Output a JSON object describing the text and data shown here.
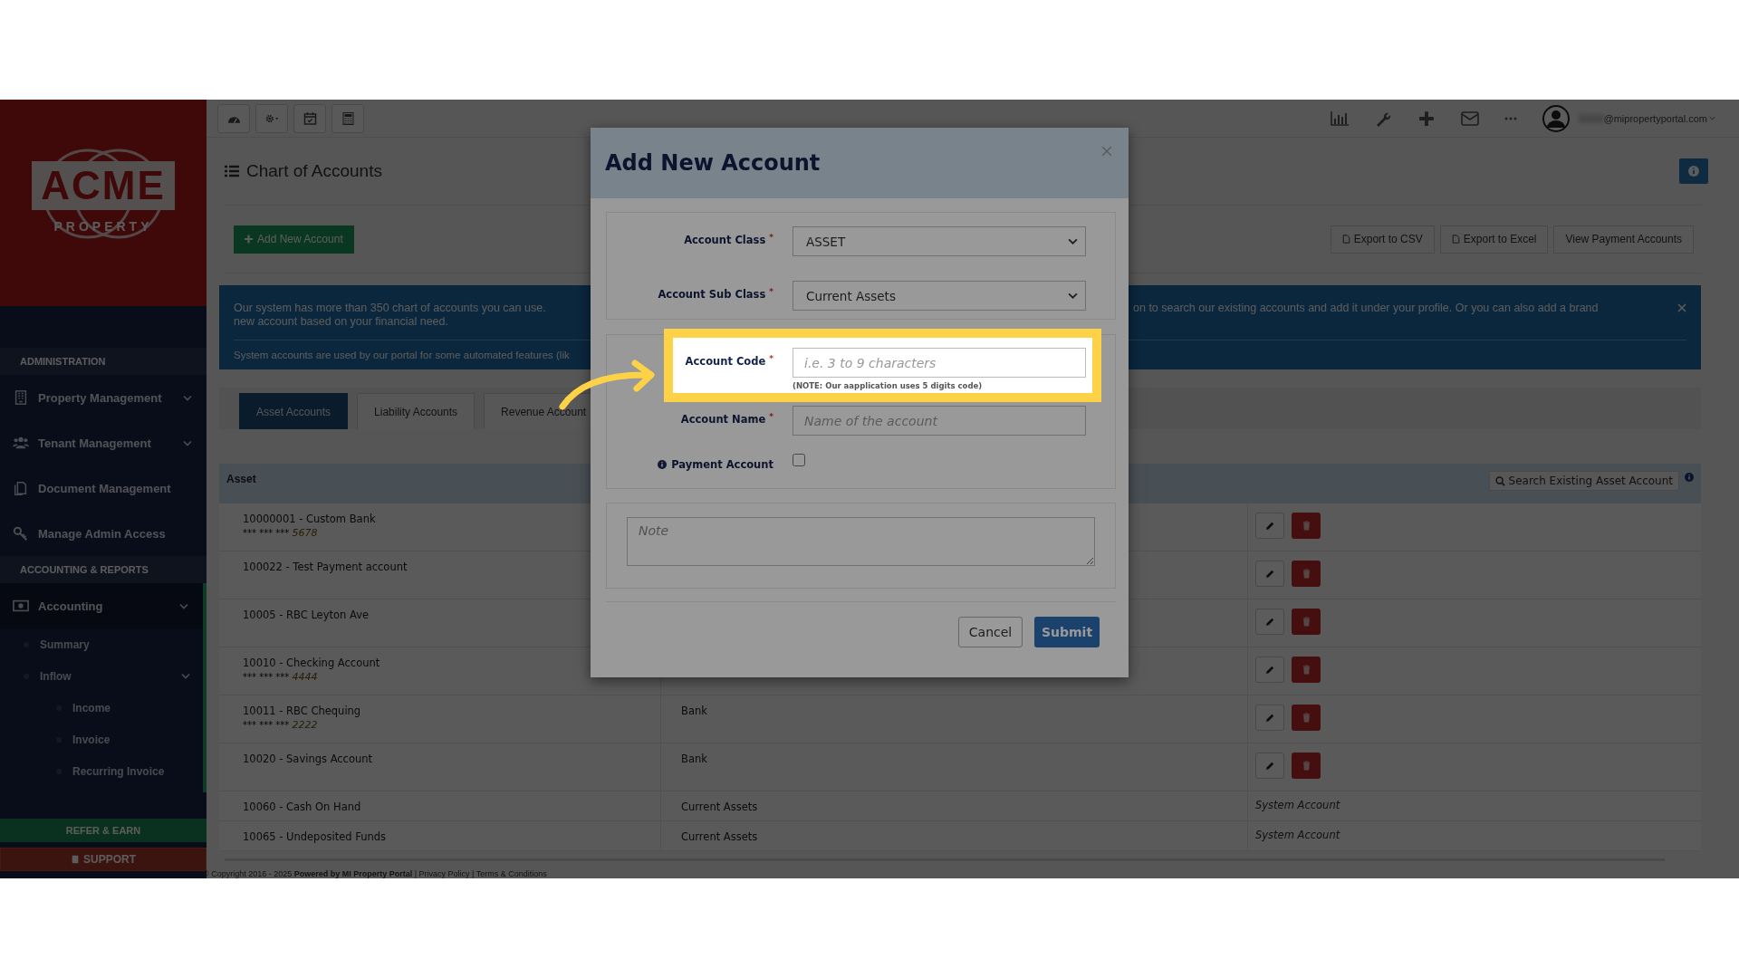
{
  "sidebar": {
    "logo": {
      "wordmark": "ACME",
      "tagline": "PROPERTY"
    },
    "sections": [
      {
        "title": "ADMINISTRATION",
        "items": [
          {
            "label": "Property Management",
            "selected": false,
            "expandable": true
          },
          {
            "label": "Tenant Management",
            "selected": false,
            "expandable": true
          },
          {
            "label": "Document Management",
            "selected": false,
            "expandable": false
          },
          {
            "label": "Manage Admin Access",
            "selected": false,
            "expandable": false
          }
        ]
      },
      {
        "title": "ACCOUNTING & REPORTS",
        "items": [
          {
            "label": "Accounting",
            "selected": true,
            "expandable": true,
            "children": [
              {
                "label": "Summary",
                "expandable": false
              },
              {
                "label": "Inflow",
                "expandable": true,
                "children": [
                  {
                    "label": "Income"
                  },
                  {
                    "label": "Invoice"
                  },
                  {
                    "label": "Recurring Invoice"
                  }
                ]
              }
            ]
          }
        ]
      }
    ],
    "refer_button": "REFER & EARN",
    "support_button": "SUPPORT"
  },
  "topbar": {
    "user_email": "@mipropertyportal.com"
  },
  "page": {
    "title": "Chart of Accounts",
    "add_button": "Add New Account",
    "export_buttons": [
      "Export to CSV",
      "Export to Excel"
    ],
    "view_button": "View Payment Accounts"
  },
  "banner": {
    "left_lines": [
      "Our system has more than 350 chart of accounts you can use.",
      "new account based on your financial need."
    ],
    "right_line": "on to search our existing accounts and add it under your profile. Or you can also add a brand",
    "note": "System accounts are used by our portal for some automated features (lik"
  },
  "tabs": [
    {
      "label": "Asset Accounts",
      "selected": true
    },
    {
      "label": "Liability Accounts",
      "selected": false
    },
    {
      "label": "Revenue Account",
      "selected": false
    }
  ],
  "table": {
    "columns": [
      "Asset"
    ],
    "search_button": "Search Existing Asset Account",
    "rows": [
      {
        "name": "10000001 - Custom Bank",
        "mask": "*** *** ***",
        "digits": "5678",
        "kind": "editable"
      },
      {
        "name": "100022 - Test Payment account",
        "kind": "editable"
      },
      {
        "name": "10005 - RBC Leyton Ave",
        "kind": "editable"
      },
      {
        "name": "10010 - Checking Account",
        "mask": "*** *** ***",
        "digits": "4444",
        "kind": "editable"
      },
      {
        "name": "10011 - RBC Chequing",
        "mask": "*** *** ***",
        "digits": "2222",
        "type": "Bank",
        "kind": "editable"
      },
      {
        "name": "10020 - Savings Account",
        "type": "Bank",
        "kind": "editable"
      },
      {
        "name": "10060 - Cash On Hand",
        "type": "Current Assets",
        "kind": "system",
        "note": "System Account"
      },
      {
        "name": "10065 - Undeposited Funds",
        "type": "Current Assets",
        "kind": "system",
        "note": "System Account"
      }
    ]
  },
  "footer": "© Copyright 2016 - 2025 **Powered by MI Property Portal** | Privacy Policy | Terms & Conditions",
  "modal": {
    "title": "Add New Account",
    "groups": [
      {
        "fields": [
          {
            "kind": "select",
            "label": "Account Class",
            "asterisk": "*",
            "value": "ASSET"
          },
          {
            "kind": "select",
            "label": "Account Sub Class",
            "asterisk": "*",
            "value": "Current Assets"
          }
        ]
      },
      {
        "fields": [
          {
            "kind": "text",
            "label": "Account Code",
            "asterisk": "*",
            "placeholder": "i.e. 3 to 9 characters",
            "hint": "(NOTE: Our aapplication uses 5 digits code)",
            "highlighted": true
          },
          {
            "kind": "text",
            "label": "Account Name",
            "asterisk": "*",
            "placeholder": "Name of the account",
            "highlighted": false
          },
          {
            "kind": "checkbox",
            "label": "Payment Account",
            "checked": false
          }
        ]
      }
    ],
    "note_placeholder": "Note",
    "cancel_button": "Cancel",
    "submit_button": "Submit"
  }
}
